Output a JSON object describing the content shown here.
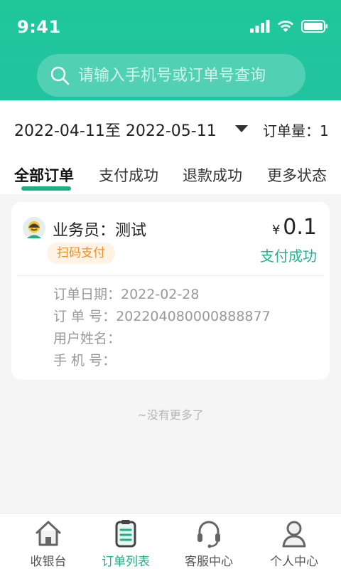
{
  "status_bar": {
    "time": "9:41"
  },
  "search": {
    "placeholder": "请输入手机号或订单号查询"
  },
  "filter": {
    "date_range": "2022-04-11至 2022-05-11",
    "order_count": "订单量：1"
  },
  "tabs": [
    {
      "label": "全部订单"
    },
    {
      "label": "支付成功"
    },
    {
      "label": "退款成功"
    },
    {
      "label": "更多状态"
    }
  ],
  "order": {
    "salesman": "业务员：测试",
    "pay_type": "扫码支付",
    "currency": "¥",
    "amount": "0.1",
    "status": "支付成功",
    "details": [
      {
        "text": "订单日期：2022-02-28"
      },
      {
        "text": "订  单  号：20220408000088887​7"
      },
      {
        "text": "用户姓名："
      },
      {
        "text": "手  机  号："
      }
    ]
  },
  "no_more": "~没有更多了",
  "tabbar": [
    {
      "label": "收银台",
      "icon": "home-icon"
    },
    {
      "label": "订单列表",
      "icon": "order-list-icon"
    },
    {
      "label": "客服中心",
      "icon": "headset-icon"
    },
    {
      "label": "个人中心",
      "icon": "user-icon"
    }
  ],
  "colors": {
    "primary": "#1fc79a",
    "accent_green": "#22b48b",
    "pay_type_orange": "#f0902a"
  }
}
